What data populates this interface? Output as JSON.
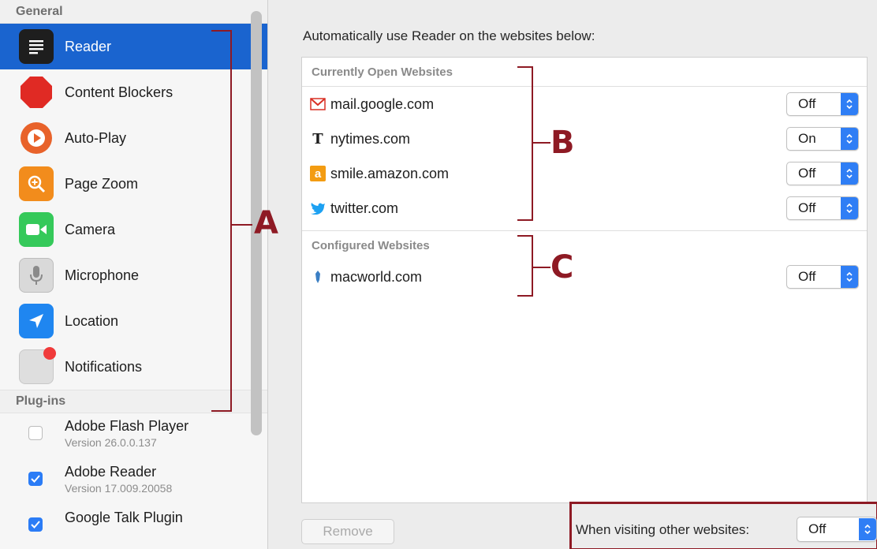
{
  "sidebar": {
    "general_header": "General",
    "items": [
      {
        "label": "Reader",
        "icon": "reader-icon",
        "active": true
      },
      {
        "label": "Content Blockers",
        "icon": "stop-sign-icon"
      },
      {
        "label": "Auto-Play",
        "icon": "play-icon"
      },
      {
        "label": "Page Zoom",
        "icon": "zoom-icon"
      },
      {
        "label": "Camera",
        "icon": "camera-icon"
      },
      {
        "label": "Microphone",
        "icon": "microphone-icon"
      },
      {
        "label": "Location",
        "icon": "location-arrow-icon"
      },
      {
        "label": "Notifications",
        "icon": "notifications-icon"
      }
    ],
    "plugins_header": "Plug-ins",
    "plugins": [
      {
        "name": "Adobe Flash Player",
        "version": "Version 26.0.0.137",
        "checked": false
      },
      {
        "name": "Adobe Reader",
        "version": "Version 17.009.20058",
        "checked": true
      },
      {
        "name": "Google Talk Plugin",
        "version": "",
        "checked": true
      }
    ]
  },
  "main": {
    "prompt": "Automatically use Reader on the websites below:",
    "groups": [
      {
        "header": "Currently Open Websites",
        "sites": [
          {
            "domain": "mail.google.com",
            "icon": "gmail-icon",
            "value": "Off"
          },
          {
            "domain": "nytimes.com",
            "icon": "nytimes-icon",
            "value": "On"
          },
          {
            "domain": "smile.amazon.com",
            "icon": "amazon-icon",
            "value": "Off"
          },
          {
            "domain": "twitter.com",
            "icon": "twitter-icon",
            "value": "Off"
          }
        ]
      },
      {
        "header": "Configured Websites",
        "sites": [
          {
            "domain": "macworld.com",
            "icon": "macworld-icon",
            "value": "Off"
          }
        ]
      }
    ],
    "remove_label": "Remove",
    "other_label": "When visiting other websites:",
    "other_value": "Off"
  },
  "annotations": {
    "a": "A",
    "b": "B",
    "c": "C"
  },
  "colors": {
    "accent": "#1a64cf",
    "popup_blue": "#2f7ef5",
    "annotation": "#8e1a24"
  }
}
